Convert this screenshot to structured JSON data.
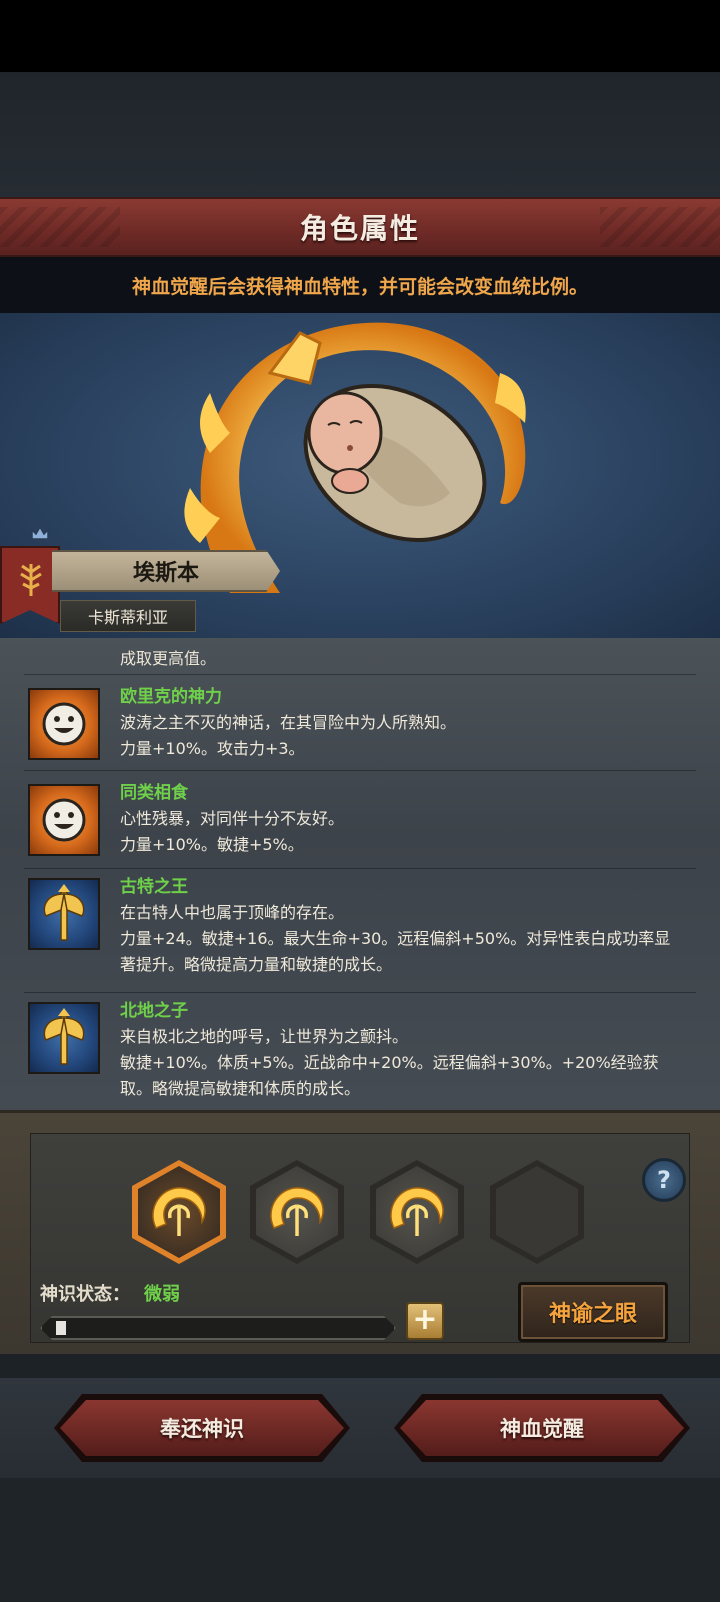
{
  "header": {
    "title": "角色属性"
  },
  "notice": {
    "text": "神血觉醒后会获得神血特性，并可能会改变血统比例。"
  },
  "character": {
    "name": "埃斯本",
    "origin": "卡斯蒂利亚"
  },
  "traits": {
    "truncated_top": "成取更高值。",
    "items": [
      {
        "name": "欧里克的神力",
        "desc": "波涛之主不灭的神话，在其冒险中为人所熟知。",
        "effect": "力量+10%。攻击力+3。",
        "icon": "smiley-face-icon",
        "color": "#e07a22"
      },
      {
        "name": "同类相食",
        "desc": "心性残暴，对同伴十分不友好。",
        "effect": "力量+10%。敏捷+5%。",
        "icon": "smiley-face-icon",
        "color": "#e07a22"
      },
      {
        "name": "古特之王",
        "desc": "在古特人中也属于顶峰的存在。",
        "effect": "力量+24。敏捷+16。最大生命+30。远程偏斜+50%。对异性表白成功率显著提升。略微提高力量和敏捷的成长。",
        "icon": "golden-axe-icon",
        "color": "#2a5590"
      },
      {
        "name": "北地之子",
        "desc": "来自极北之地的呼号，让世界为之颤抖。",
        "effect": "敏捷+10%。体质+5%。近战命中+20%。远程偏斜+30%。+20%经验获取。略微提高敏捷和体质的成长。",
        "icon": "golden-axe-icon",
        "color": "#2a5590"
      }
    ]
  },
  "divine_slots": {
    "slots": [
      {
        "state": "selected",
        "icon": "flaming-trident-icon"
      },
      {
        "state": "filled",
        "icon": "flaming-trident-icon"
      },
      {
        "state": "filled",
        "icon": "flaming-trident-icon"
      },
      {
        "state": "empty",
        "icon": ""
      }
    ],
    "help_icon": "question-mark-icon",
    "help_label": "?"
  },
  "divine_status": {
    "label": "神识状态：",
    "value": "微弱",
    "progress": 0.02,
    "plus_label": "+"
  },
  "oracle_button": {
    "label": "神谕之眼"
  },
  "actions": {
    "return_label": "奉还神识",
    "awaken_label": "神血觉醒"
  },
  "colors": {
    "accent_green": "#6fd04a",
    "accent_orange": "#f0a64a",
    "header_red": "#6e2a26"
  }
}
